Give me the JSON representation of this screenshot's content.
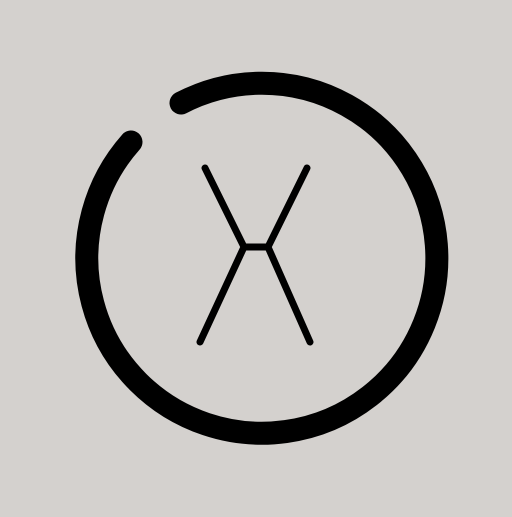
{
  "icon": {
    "name": "power-x-logo",
    "background_color": "#d4d1ce",
    "stroke_color": "#000000"
  }
}
